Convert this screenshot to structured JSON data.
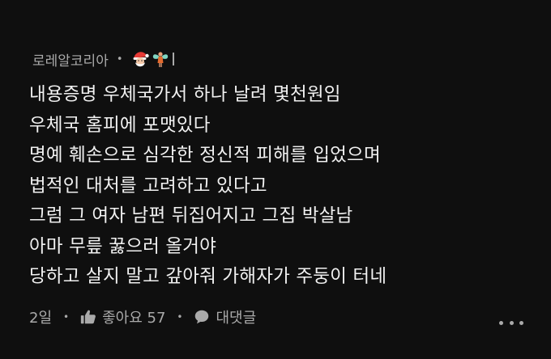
{
  "comment": {
    "author": "로레알코리아",
    "badge_icons": [
      "santa-emoji-icon",
      "fairy-emoji-icon"
    ],
    "lines": [
      "내용증명 우체국가서 하나 날려 몇천원임",
      "우체국 홈피에 포맷있다",
      "명예 훼손으로 심각한 정신적 피해를 입었으며",
      "법적인 대처를 고려하고 있다고",
      "그럼 그 여자 남편 뒤집어지고 그집 박살남",
      "아마 무릎 꿇으러 올거야",
      "당하고 살지 말고 갚아줘 가해자가 주둥이 터네"
    ],
    "age": "2일",
    "like_label": "좋아요 57",
    "reply_label": "대댓글",
    "dot": "•"
  },
  "colors": {
    "background": "#0f0f0f",
    "text": "#f1f1f1",
    "secondary": "#aaaaaa"
  }
}
